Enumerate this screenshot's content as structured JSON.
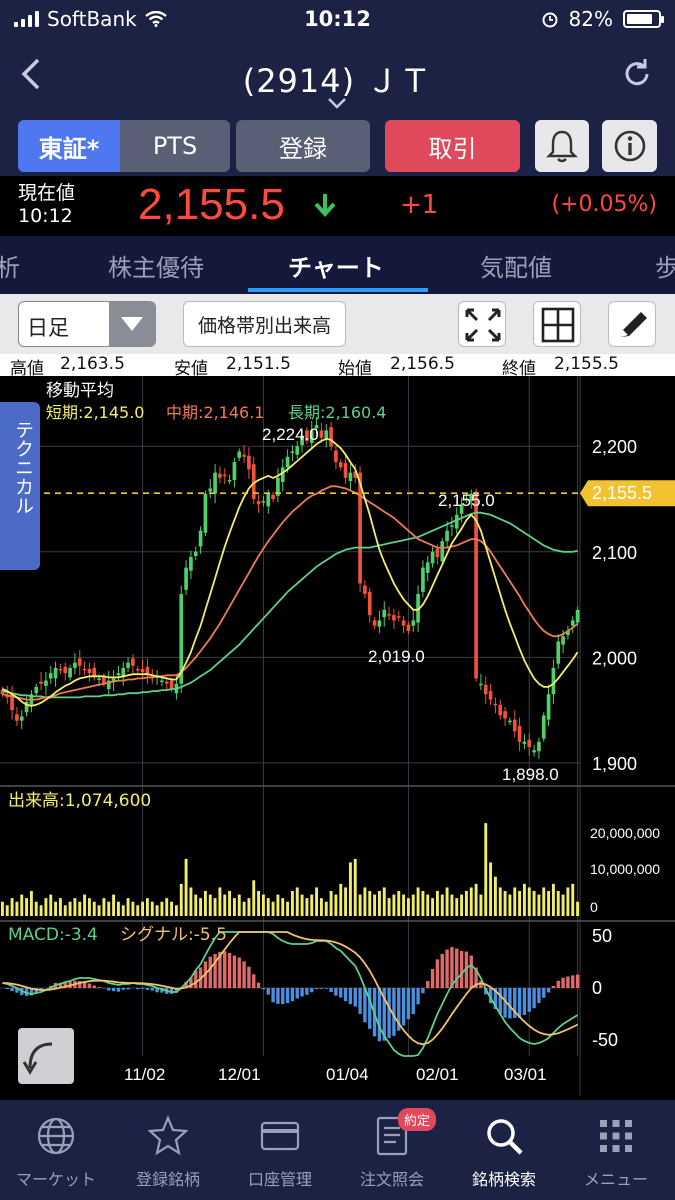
{
  "status": {
    "carrier": "SoftBank",
    "time": "10:12",
    "battery": "82%",
    "battery_level": 0.82
  },
  "nav": {
    "title": "(2914) ＪＴ",
    "back_icon": "chevron-left-icon",
    "refresh_icon": "refresh-icon"
  },
  "buttons": {
    "tse": "東証*",
    "pts": "PTS",
    "register": "登録",
    "trade": "取引",
    "bell_icon": "bell-icon",
    "info_icon": "info-icon"
  },
  "quote": {
    "label": "現在値",
    "time": "10:12",
    "price": "2,155.5",
    "direction": "down",
    "change": "+1",
    "change_pct": "(+0.05%)"
  },
  "tabs": [
    "析",
    "株主優待",
    "チャート",
    "気配値",
    "歩"
  ],
  "active_tab": "チャート",
  "chart_controls": {
    "period": "日足",
    "volume_profile": "価格帯別出来高"
  },
  "ohlc": {
    "high_label": "高値",
    "high": "2,163.5",
    "low_label": "安値",
    "low": "2,151.5",
    "open_label": "始値",
    "open": "2,156.5",
    "close_label": "終値",
    "close": "2,155.5"
  },
  "technical_tab": "テクニカル",
  "chart_data": {
    "type": "candlestick",
    "price_axis": {
      "ticks": [
        2200,
        2100,
        2000,
        1900
      ],
      "tick_labels": [
        "2,200",
        "2,100",
        "2,000",
        "1,900"
      ],
      "range": [
        1880,
        2240
      ]
    },
    "current_price_label": "2,155.5",
    "current_price": 2155.5,
    "ma_title": "移動平均",
    "ma_legend": [
      {
        "name": "短期",
        "value": "2,145.0",
        "color": "#f2ee6a"
      },
      {
        "name": "中期",
        "value": "2,146.1",
        "color": "#ef7b56"
      },
      {
        "name": "長期",
        "value": "2,160.4",
        "color": "#5ed08b"
      }
    ],
    "annotations": [
      {
        "text": "2,224.0",
        "value": 2224.0
      },
      {
        "text": "2,155.0",
        "value": 2155.0
      },
      {
        "text": "2,019.0",
        "value": 2019.0
      },
      {
        "text": "1,898.0",
        "value": 1898.0
      }
    ],
    "x_dates": [
      "11/02",
      "12/01",
      "01/04",
      "02/01",
      "03/01"
    ],
    "closes": [
      1965,
      1962,
      1950,
      1940,
      1944,
      1958,
      1965,
      1972,
      1975,
      1978,
      1985,
      1990,
      1988,
      1985,
      1990,
      1995,
      1992,
      1988,
      1985,
      1982,
      1980,
      1975,
      1978,
      1980,
      1985,
      1990,
      1995,
      1992,
      1988,
      1986,
      1984,
      1980,
      1982,
      1978,
      1975,
      1970,
      1975,
      2060,
      2085,
      2095,
      2100,
      2120,
      2155,
      2160,
      2175,
      2170,
      2172,
      2168,
      2185,
      2195,
      2190,
      2178,
      2150,
      2145,
      2148,
      2155,
      2150,
      2170,
      2180,
      2190,
      2195,
      2200,
      2210,
      2205,
      2215,
      2220,
      2208,
      2215,
      2200,
      2185,
      2180,
      2170,
      2175,
      2170,
      2070,
      2060,
      2040,
      2030,
      2035,
      2045,
      2040,
      2035,
      2038,
      2030,
      2025,
      2035,
      2060,
      2085,
      2090,
      2100,
      2095,
      2110,
      2120,
      2125,
      2135,
      2145,
      2150,
      2155,
      1980,
      1975,
      1965,
      1960,
      1955,
      1945,
      1942,
      1940,
      1930,
      1920,
      1920,
      1915,
      1912,
      1920,
      1945,
      1965,
      1990,
      2015,
      2020,
      2025,
      2035,
      2045
    ],
    "ma_short": [
      1970,
      1968,
      1965,
      1962,
      1958,
      1955,
      1954,
      1955,
      1957,
      1960,
      1963,
      1967,
      1970,
      1973,
      1975,
      1978,
      1980,
      1981,
      1982,
      1982,
      1982,
      1982,
      1981,
      1981,
      1981,
      1982,
      1983,
      1984,
      1984,
      1984,
      1984,
      1983,
      1982,
      1981,
      1980,
      1979,
      1979,
      1986,
      1995,
      2005,
      2018,
      2030,
      2045,
      2060,
      2075,
      2090,
      2105,
      2118,
      2130,
      2142,
      2152,
      2160,
      2165,
      2168,
      2170,
      2172,
      2170,
      2172,
      2175,
      2178,
      2182,
      2186,
      2190,
      2194,
      2198,
      2202,
      2205,
      2207,
      2206,
      2202,
      2198,
      2192,
      2185,
      2178,
      2165,
      2150,
      2135,
      2118,
      2102,
      2090,
      2080,
      2070,
      2062,
      2055,
      2050,
      2045,
      2045,
      2050,
      2058,
      2068,
      2078,
      2088,
      2098,
      2108,
      2115,
      2122,
      2130,
      2135,
      2130,
      2120,
      2105,
      2090,
      2075,
      2060,
      2045,
      2032,
      2020,
      2008,
      1997,
      1988,
      1980,
      1975,
      1972,
      1972,
      1975,
      1980,
      1986,
      1992,
      1998,
      2005
    ],
    "ma_mid": [
      1965,
      1964,
      1963,
      1962,
      1961,
      1960,
      1960,
      1960,
      1961,
      1962,
      1963,
      1964,
      1966,
      1967,
      1968,
      1969,
      1970,
      1971,
      1972,
      1973,
      1974,
      1975,
      1976,
      1977,
      1978,
      1978,
      1979,
      1979,
      1980,
      1980,
      1981,
      1981,
      1982,
      1982,
      1983,
      1983,
      1983,
      1986,
      1990,
      1995,
      2000,
      2006,
      2012,
      2018,
      2025,
      2032,
      2040,
      2048,
      2056,
      2064,
      2072,
      2080,
      2088,
      2096,
      2103,
      2110,
      2116,
      2122,
      2128,
      2133,
      2138,
      2142,
      2146,
      2150,
      2153,
      2155,
      2158,
      2160,
      2162,
      2162,
      2161,
      2160,
      2158,
      2156,
      2153,
      2150,
      2147,
      2144,
      2141,
      2138,
      2135,
      2132,
      2128,
      2124,
      2120,
      2116,
      2112,
      2110,
      2108,
      2106,
      2104,
      2104,
      2104,
      2105,
      2106,
      2108,
      2110,
      2112,
      2112,
      2110,
      2106,
      2100,
      2093,
      2086,
      2079,
      2072,
      2065,
      2058,
      2050,
      2043,
      2036,
      2030,
      2025,
      2022,
      2020,
      2020,
      2022,
      2025,
      2028,
      2032
    ],
    "ma_long": [
      1968,
      1967,
      1966,
      1965,
      1964,
      1964,
      1963,
      1963,
      1963,
      1962,
      1962,
      1962,
      1962,
      1962,
      1962,
      1962,
      1962,
      1963,
      1963,
      1963,
      1963,
      1964,
      1964,
      1964,
      1965,
      1965,
      1966,
      1966,
      1966,
      1967,
      1967,
      1968,
      1968,
      1969,
      1969,
      1970,
      1970,
      1972,
      1974,
      1976,
      1979,
      1982,
      1985,
      1988,
      1992,
      1996,
      2000,
      2004,
      2008,
      2012,
      2017,
      2022,
      2027,
      2032,
      2037,
      2042,
      2047,
      2052,
      2057,
      2062,
      2066,
      2070,
      2074,
      2078,
      2082,
      2086,
      2089,
      2092,
      2095,
      2098,
      2100,
      2102,
      2103,
      2104,
      2104,
      2104,
      2104,
      2105,
      2106,
      2107,
      2108,
      2109,
      2110,
      2111,
      2112,
      2113,
      2114,
      2116,
      2118,
      2120,
      2122,
      2124,
      2126,
      2128,
      2130,
      2132,
      2134,
      2136,
      2137,
      2137,
      2136,
      2135,
      2133,
      2131,
      2129,
      2127,
      2124,
      2121,
      2118,
      2115,
      2112,
      2109,
      2106,
      2104,
      2102,
      2101,
      2100,
      2100,
      2100,
      2101
    ],
    "volume": {
      "label": "出来高:1,074,600",
      "ticks": [
        "20,000,000",
        "10,000,000",
        "0"
      ],
      "tick_values": [
        20000000,
        10000000,
        0
      ],
      "values": [
        4,
        3,
        5,
        4,
        6,
        5,
        7,
        4,
        3,
        5,
        6,
        4,
        5,
        3,
        4,
        5,
        4,
        6,
        5,
        4,
        3,
        5,
        4,
        6,
        4,
        3,
        5,
        4,
        3,
        4,
        5,
        4,
        3,
        4,
        5,
        4,
        3,
        9,
        16,
        8,
        6,
        5,
        7,
        6,
        5,
        8,
        6,
        7,
        5,
        6,
        4,
        5,
        10,
        7,
        6,
        5,
        4,
        6,
        5,
        4,
        7,
        8,
        6,
        5,
        6,
        8,
        5,
        4,
        7,
        6,
        9,
        8,
        15,
        16,
        6,
        8,
        7,
        6,
        7,
        8,
        5,
        6,
        7,
        6,
        5,
        6,
        8,
        7,
        6,
        5,
        7,
        6,
        8,
        6,
        5,
        6,
        7,
        8,
        9,
        6,
        26,
        15,
        11,
        8,
        7,
        6,
        8,
        7,
        9,
        8,
        7,
        6,
        8,
        7,
        9,
        7,
        6,
        8,
        9,
        4
      ]
    },
    "macd": {
      "label": "MACD:-3.4",
      "signal_label": "シグナル:-5.5",
      "ticks": [
        "50",
        "0",
        "-50"
      ],
      "tick_values": [
        50,
        0,
        -50
      ]
    }
  },
  "bottom_nav": [
    {
      "label": "マーケット",
      "icon": "globe-icon"
    },
    {
      "label": "登録銘柄",
      "icon": "star-icon"
    },
    {
      "label": "口座管理",
      "icon": "card-icon"
    },
    {
      "label": "注文照会",
      "icon": "document-icon"
    },
    {
      "label": "銘柄検索",
      "icon": "search-icon",
      "active": true
    },
    {
      "label": "メニュー",
      "icon": "grid-icon"
    }
  ],
  "badge": "約定"
}
